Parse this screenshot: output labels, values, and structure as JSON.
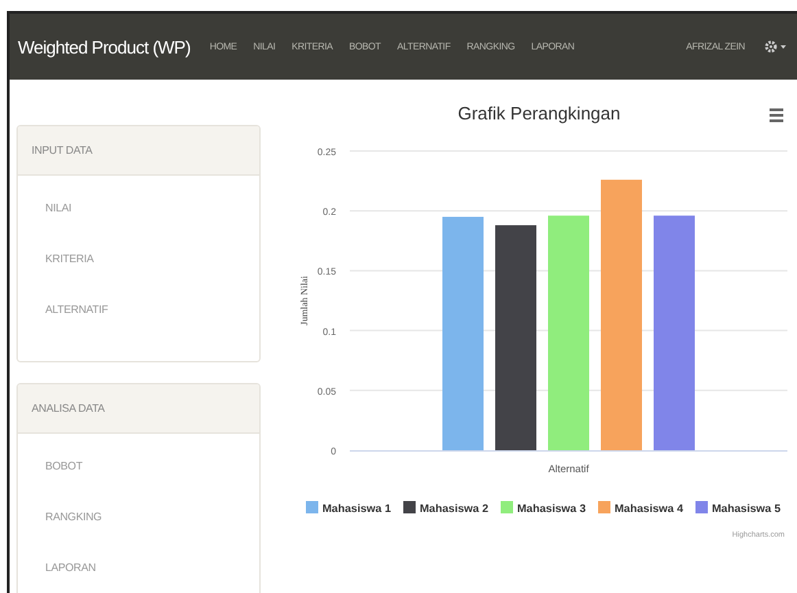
{
  "navbar": {
    "brand": "Weighted Product (WP)",
    "menu": [
      "HOME",
      "NILAI",
      "KRITERIA",
      "BOBOT",
      "ALTERNATIF",
      "RANGKING",
      "LAPORAN"
    ],
    "user": "AFRIZAL ZEIN"
  },
  "sidebar": {
    "panels": [
      {
        "title": "INPUT DATA",
        "items": [
          "NILAI",
          "KRITERIA",
          "ALTERNATIF"
        ]
      },
      {
        "title": "ANALISA DATA",
        "items": [
          "BOBOT",
          "RANGKING",
          "LAPORAN"
        ]
      }
    ]
  },
  "chart": {
    "chart_data": {
      "type": "bar",
      "title": "Grafik Perangkingan",
      "ylabel": "Jumlah Nilai",
      "categories": [
        "Alternatif"
      ],
      "series": [
        {
          "name": "Mahasiswa 1",
          "color": "#7cb5ec",
          "values": [
            0.195
          ]
        },
        {
          "name": "Mahasiswa 2",
          "color": "#434348",
          "values": [
            0.188
          ]
        },
        {
          "name": "Mahasiswa 3",
          "color": "#90ed7d",
          "values": [
            0.196
          ]
        },
        {
          "name": "Mahasiswa 4",
          "color": "#f7a35c",
          "values": [
            0.226
          ]
        },
        {
          "name": "Mahasiswa 5",
          "color": "#8085e9",
          "values": [
            0.196
          ]
        }
      ],
      "grid": true,
      "legend": true,
      "ylim": [
        0,
        0.25
      ],
      "yticks": [
        0,
        0.05,
        0.1,
        0.15,
        0.2,
        0.25
      ]
    },
    "credits": "Highcharts.com"
  }
}
